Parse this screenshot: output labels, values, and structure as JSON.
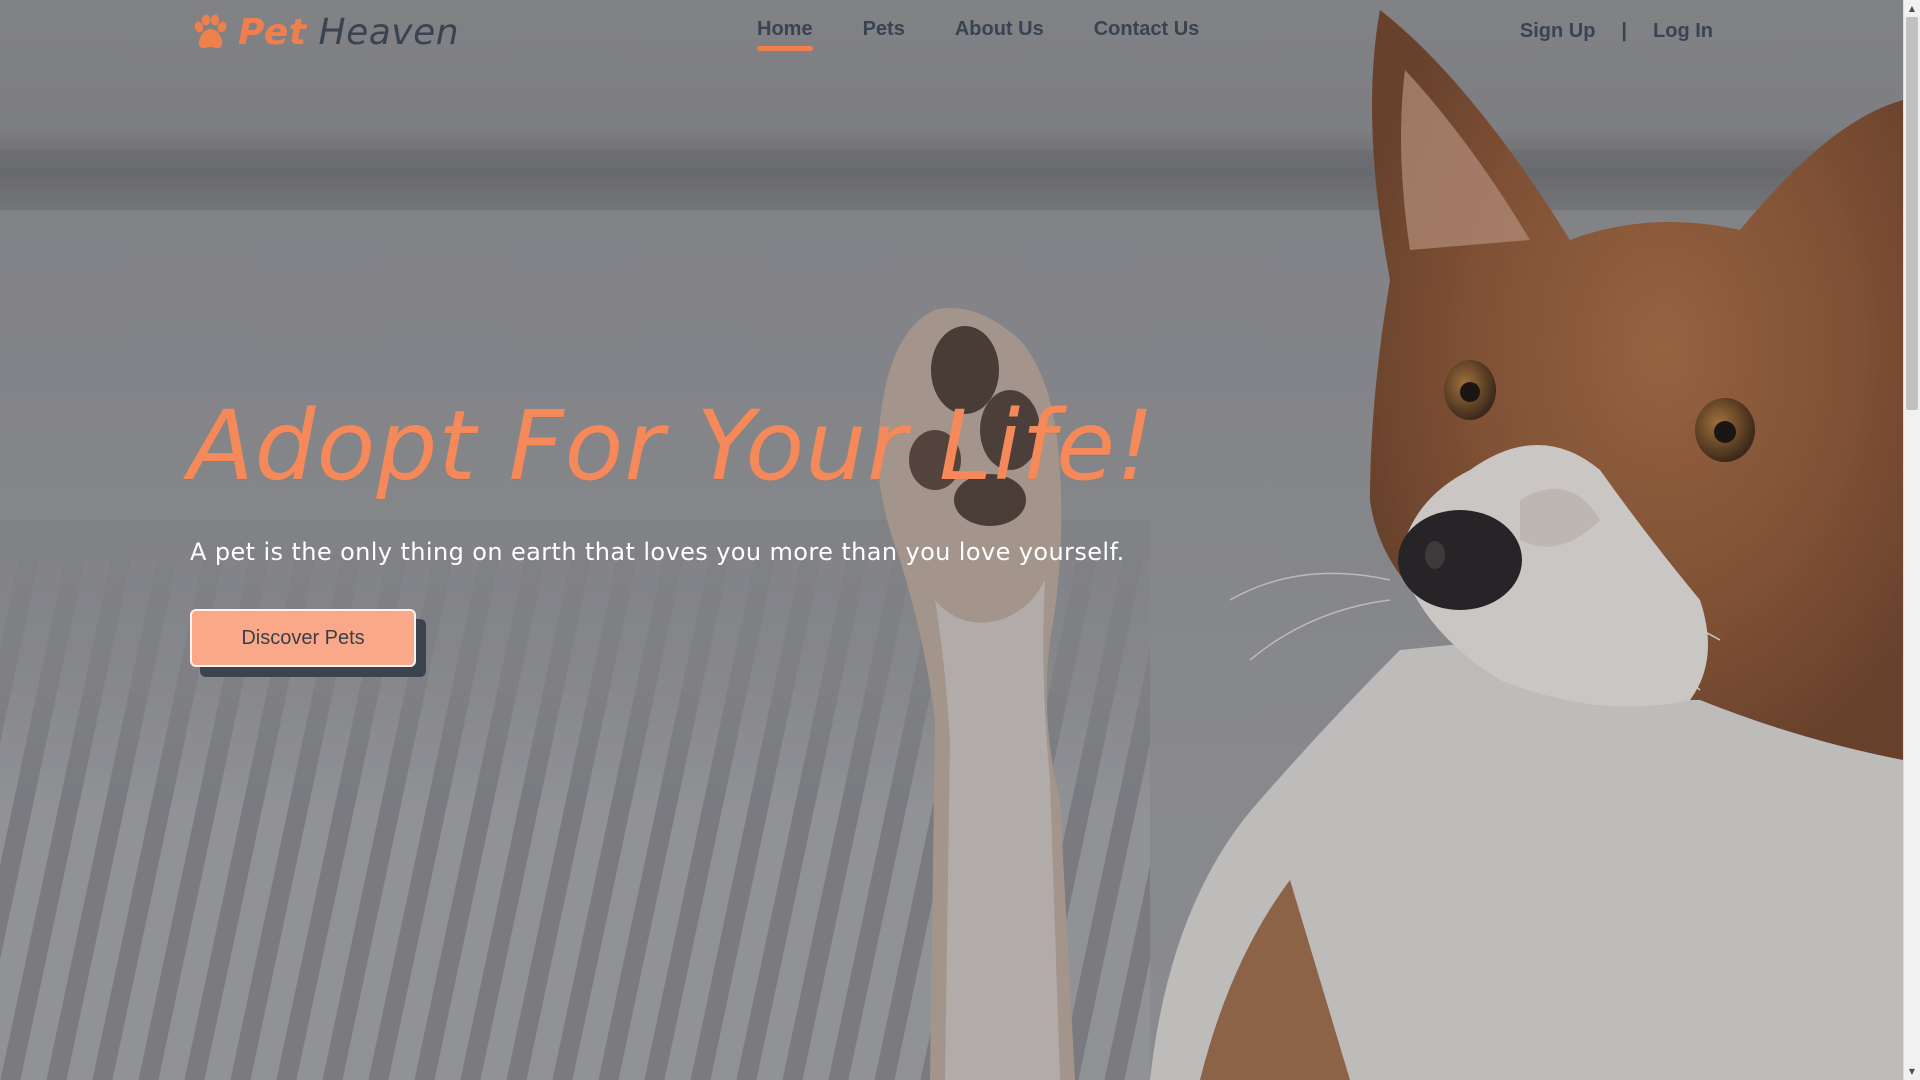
{
  "brand": {
    "name_part1": "Pet",
    "name_part2": "Heaven",
    "icon": "paw-icon",
    "accent_color": "#f07f4e"
  },
  "nav": {
    "items": [
      {
        "label": "Home",
        "active": true
      },
      {
        "label": "Pets",
        "active": false
      },
      {
        "label": "About Us",
        "active": false
      },
      {
        "label": "Contact Us",
        "active": false
      }
    ]
  },
  "auth": {
    "signup_label": "Sign Up",
    "separator": "|",
    "login_label": "Log In"
  },
  "hero": {
    "title": "Adopt For Your Life!",
    "subtitle": "A pet is the only thing on earth that loves you more than you love yourself.",
    "cta_label": "Discover Pets",
    "cta_color": "#f9a989",
    "cta_shadow_color": "#3b4350"
  },
  "scrollbar": {
    "up_icon": "arrow-up-icon",
    "down_icon": "arrow-down-icon"
  }
}
